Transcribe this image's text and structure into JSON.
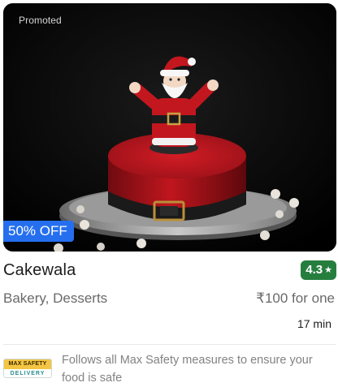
{
  "restaurant": {
    "promoted_label": "Promoted",
    "offer": "50% OFF",
    "name": "Cakewala",
    "rating": "4.3",
    "rating_icon": "star-icon",
    "cuisines": "Bakery, Desserts",
    "price": "₹100 for one",
    "delivery_time": "17 min"
  },
  "safety": {
    "logo_top": "MAX SAFETY",
    "logo_bottom": "DELIVERY",
    "text": "Follows all Max Safety measures to ensure your food is safe"
  },
  "colors": {
    "rating_green": "#267e3e",
    "offer_blue": "#256fef",
    "cake_red": "#b3141c"
  }
}
